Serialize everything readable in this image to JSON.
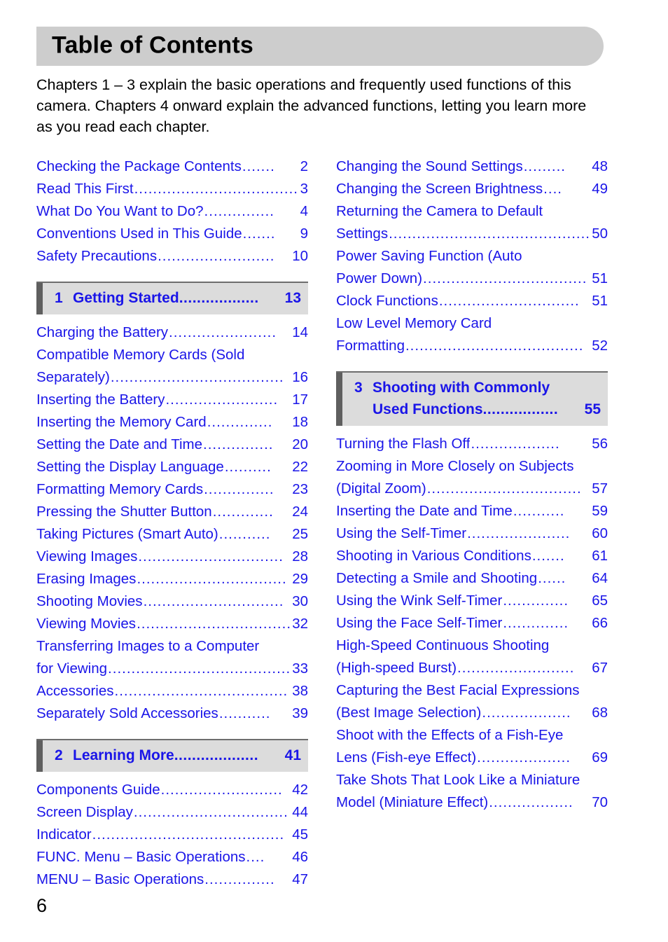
{
  "page": {
    "title": "Table of Contents",
    "intro": "Chapters 1 – 3 explain the basic operations and frequently used functions of this camera. Chapters 4 onward explain the advanced functions, letting you learn more as you read each chapter.",
    "folio": "6",
    "colors": {
      "link_blue": "#1a15e8",
      "banner_gray": "#cdcdcd",
      "chapter_bar_gray": "#dcdcdc",
      "chapter_accent_gray": "#5f5f5f",
      "text_black": "#000000"
    }
  },
  "left_column": {
    "front_matter": [
      {
        "label": "Checking the Package Contents",
        "page": "2",
        "leader": "......."
      },
      {
        "label": "Read This First",
        "page": "3",
        "leader": "..................................."
      },
      {
        "label": "What Do You Want to Do?",
        "page": "4",
        "leader": "..............."
      },
      {
        "label": "Conventions Used in This Guide",
        "page": "9",
        "leader": "......."
      },
      {
        "label": "Safety Precautions",
        "page": "10",
        "leader": "........................."
      }
    ],
    "chapter_1": {
      "number": "1",
      "title": "Getting Started",
      "page": "13",
      "leader": "..................",
      "entries": [
        {
          "lines": [
            "Charging the Battery"
          ],
          "page": "14",
          "leader": "......................."
        },
        {
          "lines": [
            "Compatible Memory Cards (Sold",
            "Separately)"
          ],
          "page": "16",
          "leader": "....................................."
        },
        {
          "lines": [
            "Inserting the Battery"
          ],
          "page": "17",
          "leader": "........................"
        },
        {
          "lines": [
            "Inserting the Memory Card"
          ],
          "page": "18",
          "leader": ".............."
        },
        {
          "lines": [
            "Setting the Date and Time"
          ],
          "page": "20",
          "leader": "..............."
        },
        {
          "lines": [
            "Setting the Display Language"
          ],
          "page": "22",
          "leader": ".........."
        },
        {
          "lines": [
            "Formatting Memory Cards"
          ],
          "page": "23",
          "leader": "..............."
        },
        {
          "lines": [
            "Pressing the Shutter Button"
          ],
          "page": "24",
          "leader": "............."
        },
        {
          "lines": [
            "Taking Pictures (Smart Auto)"
          ],
          "page": "25",
          "leader": "..........."
        },
        {
          "lines": [
            "Viewing Images"
          ],
          "page": "28",
          "leader": "..............................."
        },
        {
          "lines": [
            "Erasing Images"
          ],
          "page": "29",
          "leader": "................................"
        },
        {
          "lines": [
            "Shooting Movies"
          ],
          "page": "30",
          "leader": ".............................."
        },
        {
          "lines": [
            "Viewing Movies"
          ],
          "page": "32",
          "leader": "................................."
        },
        {
          "lines": [
            "Transferring Images to a Computer",
            "for Viewing"
          ],
          "page": "33",
          "leader": "......................................."
        },
        {
          "lines": [
            "Accessories"
          ],
          "page": "38",
          "leader": "....................................."
        },
        {
          "lines": [
            "Separately Sold Accessories"
          ],
          "page": "39",
          "leader": "..........."
        }
      ]
    },
    "chapter_2": {
      "number": "2",
      "title": "Learning More",
      "page": "41",
      "leader": "...................",
      "entries": [
        {
          "lines": [
            "Components Guide"
          ],
          "page": "42",
          "leader": ".........................."
        },
        {
          "lines": [
            "Screen Display"
          ],
          "page": "44",
          "leader": "................................."
        },
        {
          "lines": [
            "Indicator"
          ],
          "page": "45",
          "leader": "........................................."
        },
        {
          "lines": [
            "FUNC. Menu – Basic Operations"
          ],
          "page": "46",
          "leader": "...."
        },
        {
          "lines": [
            "MENU – Basic Operations"
          ],
          "page": "47",
          "leader": "..............."
        }
      ]
    }
  },
  "right_column": {
    "continued_entries": [
      {
        "lines": [
          "Changing the Sound Settings"
        ],
        "page": "48",
        "leader": "........."
      },
      {
        "lines": [
          "Changing the Screen Brightness"
        ],
        "page": "49",
        "leader": "...."
      },
      {
        "lines": [
          "Returning the Camera to Default",
          "Settings"
        ],
        "page": "50",
        "leader": "..........................................."
      },
      {
        "lines": [
          "Power Saving Function (Auto",
          "Power Down)"
        ],
        "page": "51",
        "leader": "..................................."
      },
      {
        "lines": [
          "Clock Functions"
        ],
        "page": "51",
        "leader": ".............................."
      },
      {
        "lines": [
          "Low Level Memory Card",
          "Formatting"
        ],
        "page": "52",
        "leader": "......................................"
      }
    ],
    "chapter_3": {
      "number": "3",
      "title_line1": "Shooting with Commonly",
      "title_line2": "Used Functions",
      "page": "55",
      "leader": ".................",
      "entries": [
        {
          "lines": [
            "Turning the Flash Off"
          ],
          "page": "56",
          "leader": "..................."
        },
        {
          "lines": [
            "Zooming in More Closely on Subjects",
            "(Digital Zoom)"
          ],
          "page": "57",
          "leader": "................................."
        },
        {
          "lines": [
            "Inserting the Date and Time"
          ],
          "page": "59",
          "leader": "..........."
        },
        {
          "lines": [
            "Using the Self-Timer"
          ],
          "page": "60",
          "leader": "......................"
        },
        {
          "lines": [
            "Shooting in Various Conditions"
          ],
          "page": "61",
          "leader": "......."
        },
        {
          "lines": [
            "Detecting a Smile and Shooting"
          ],
          "page": "64",
          "leader": "......"
        },
        {
          "lines": [
            "Using the Wink Self-Timer"
          ],
          "page": "65",
          "leader": ".............."
        },
        {
          "lines": [
            "Using the Face Self-Timer"
          ],
          "page": "66",
          "leader": ".............."
        },
        {
          "lines": [
            "High-Speed Continuous Shooting",
            "(High-speed Burst)"
          ],
          "page": "67",
          "leader": "........................."
        },
        {
          "lines": [
            "Capturing the Best Facial Expressions",
            "(Best Image Selection)"
          ],
          "page": "68",
          "leader": "..................."
        },
        {
          "lines": [
            "Shoot with the Effects of a Fish-Eye",
            "Lens (Fish-eye Effect)"
          ],
          "page": "69",
          "leader": "...................."
        },
        {
          "lines": [
            "Take Shots That Look Like a Miniature",
            "Model (Miniature Effect)"
          ],
          "page": "70",
          "leader": ".................."
        }
      ]
    }
  }
}
